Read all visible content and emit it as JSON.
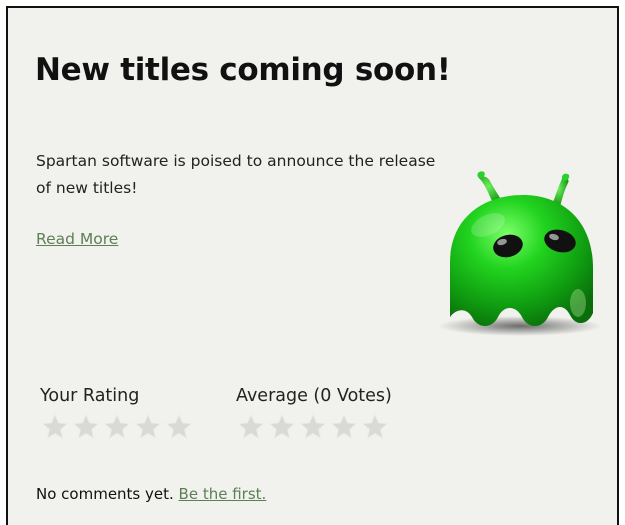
{
  "post": {
    "title": "New titles coming soon!",
    "description": "Spartan software is poised to announce the release of new titles!",
    "read_more_label": "Read More",
    "image_icon": "green-alien-ghost-icon"
  },
  "rating": {
    "your_label": "Your Rating",
    "average_label": "Average (0 Votes)",
    "your_stars_filled": 0,
    "average_stars_filled": 0,
    "max_stars": 5
  },
  "comments": {
    "empty_text": "No comments yet. ",
    "be_first_label": "Be the first."
  },
  "colors": {
    "background": "#f1f2ee",
    "link": "#5e7f56",
    "border": "#111111",
    "star_empty": "#d9dad6",
    "mascot_green": "#1fbf1f"
  }
}
